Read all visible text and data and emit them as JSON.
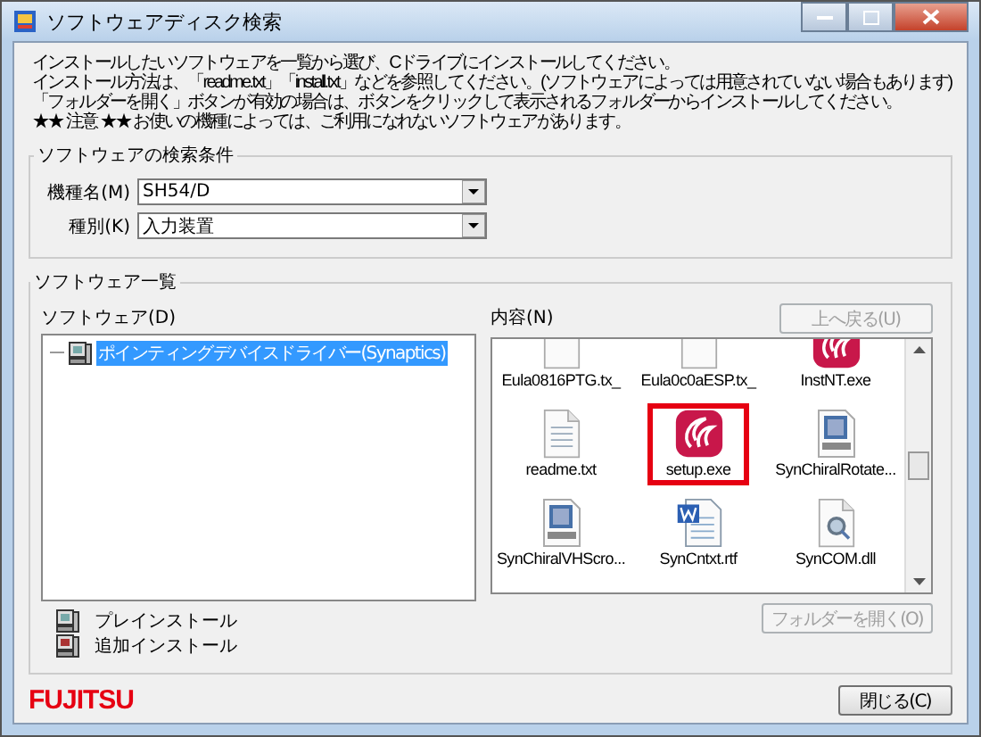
{
  "window": {
    "title": "ソフトウェアディスク検索"
  },
  "instructions": [
    "インストールしたいソフトウェアを一覧から選び、Cドライブにインストールしてください。",
    "インストール方法は、「readme.txt」「install.txt」などを参照してください。(ソフトウェアによっては用意されていない場合もあります)",
    "「フォルダーを開く」ボタンが有効の場合は、ボタンをクリックして表示されるフォルダーからインストールしてください。",
    "★★ 注意 ★★ お使いの機種によっては、ご利用になれないソフトウェアがあります。"
  ],
  "search_group": {
    "title": "ソフトウェアの検索条件",
    "fields": [
      {
        "label": "機種名(M)",
        "value": "SH54/D"
      },
      {
        "label": "種別(K)",
        "value": "入力装置"
      }
    ]
  },
  "list_group": {
    "title": "ソフトウェア一覧",
    "software_label": "ソフトウェア(D)",
    "tree": [
      {
        "label": "ポインティングデバイスドライバー(Synaptics)",
        "selected": true
      }
    ],
    "content_label": "内容(N)",
    "up_button": {
      "label": "上へ戻る(U)",
      "disabled": true
    },
    "files": [
      {
        "name": "Eula0816PTG.tx_",
        "kind": "doc",
        "highlighted": false
      },
      {
        "name": "Eula0c0aESP.tx_",
        "kind": "doc",
        "highlighted": false
      },
      {
        "name": "InstNT.exe",
        "kind": "app",
        "highlighted": false
      },
      {
        "name": "readme.txt",
        "kind": "text",
        "highlighted": false
      },
      {
        "name": "setup.exe",
        "kind": "app",
        "highlighted": true
      },
      {
        "name": "SynChiralRotate...",
        "kind": "video",
        "highlighted": false
      },
      {
        "name": "SynChiralVHScro...",
        "kind": "video",
        "highlighted": false
      },
      {
        "name": "SynCntxt.rtf",
        "kind": "word",
        "highlighted": false
      },
      {
        "name": "SynCOM.dll",
        "kind": "dll",
        "highlighted": false
      }
    ],
    "legend": [
      {
        "label": "プレインストール",
        "kind": "preinstall"
      },
      {
        "label": "追加インストール",
        "kind": "added"
      }
    ],
    "folder_button": {
      "label": "フォルダーを開く(O)",
      "disabled": true
    }
  },
  "logo": "FUJITSU",
  "close_button": {
    "label": "閉じる(C)"
  }
}
